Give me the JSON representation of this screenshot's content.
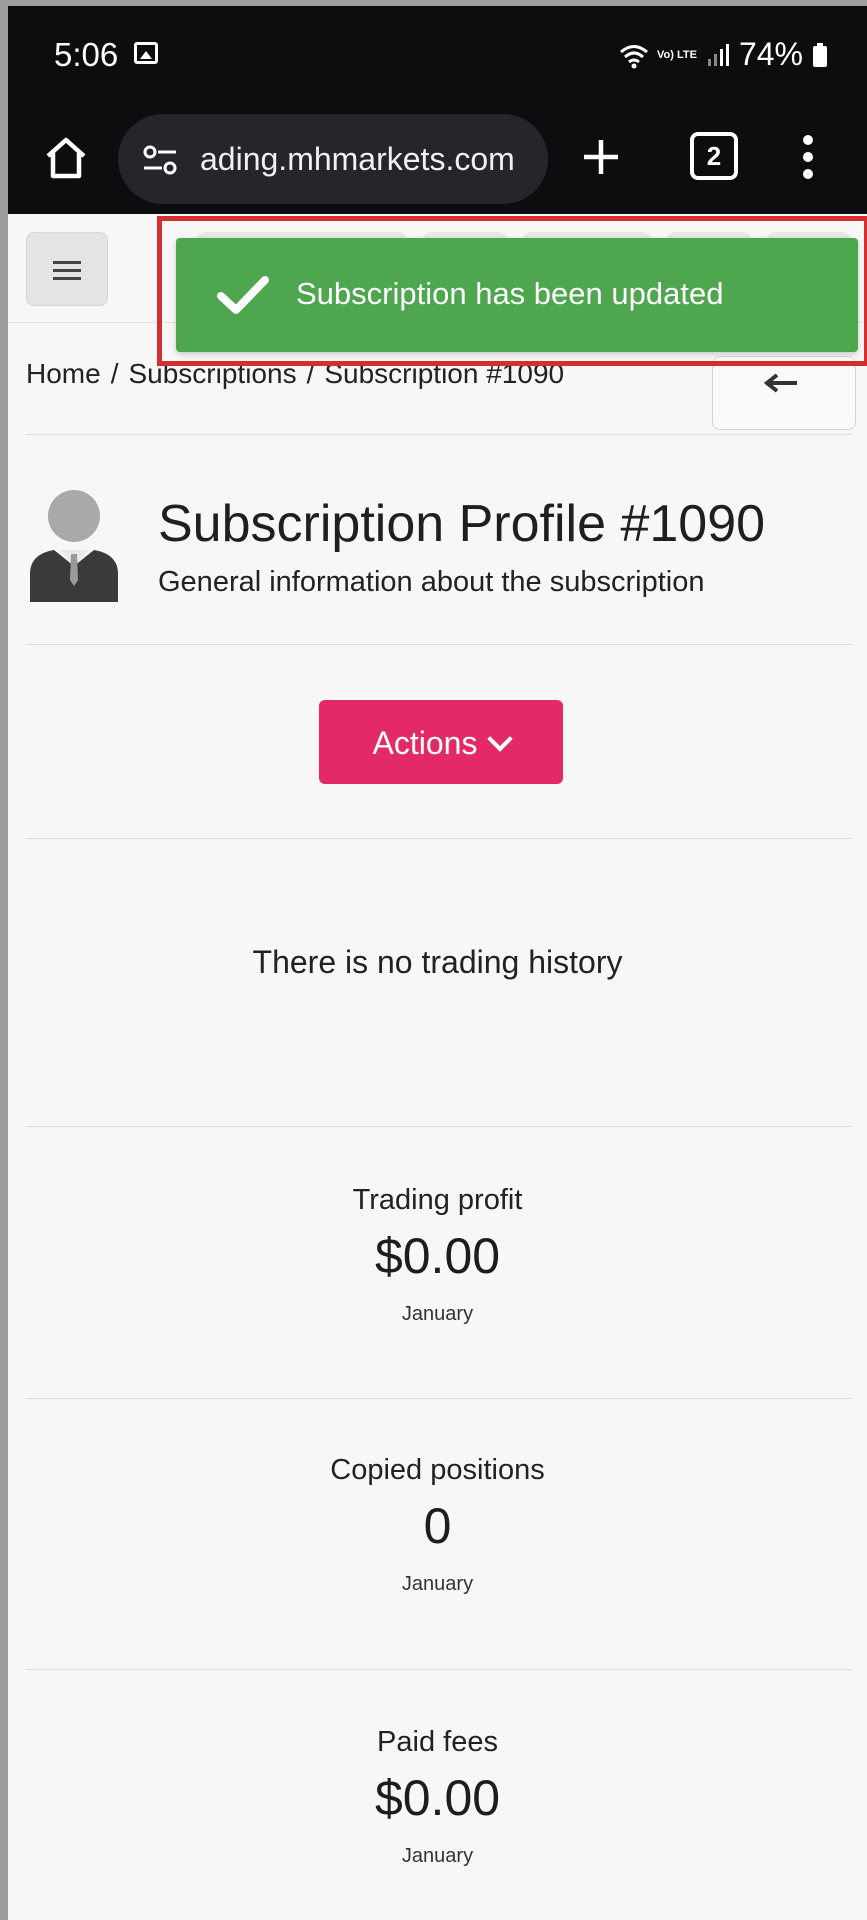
{
  "status_bar": {
    "time": "5:06",
    "battery": "74%",
    "volte": "Vo) LTE"
  },
  "browser": {
    "url": "ading.mhmarkets.com",
    "tab_count": "2"
  },
  "toast": {
    "message": "Subscription has been updated",
    "color": "#4ea64f",
    "highlight_color": "#d32f2f"
  },
  "breadcrumb": {
    "items": [
      "Home",
      "Subscriptions",
      "Subscription #1090"
    ],
    "separator": "/"
  },
  "profile": {
    "title": "Subscription Profile #1090",
    "subtitle": "General information about the subscription"
  },
  "actions": {
    "label": "Actions",
    "color": "#e42a66"
  },
  "history": {
    "empty_message": "There is no trading history"
  },
  "stats": [
    {
      "label": "Trading profit",
      "value": "$0.00",
      "period": "January"
    },
    {
      "label": "Copied positions",
      "value": "0",
      "period": "January"
    },
    {
      "label": "Paid fees",
      "value": "$0.00",
      "period": "January"
    }
  ]
}
